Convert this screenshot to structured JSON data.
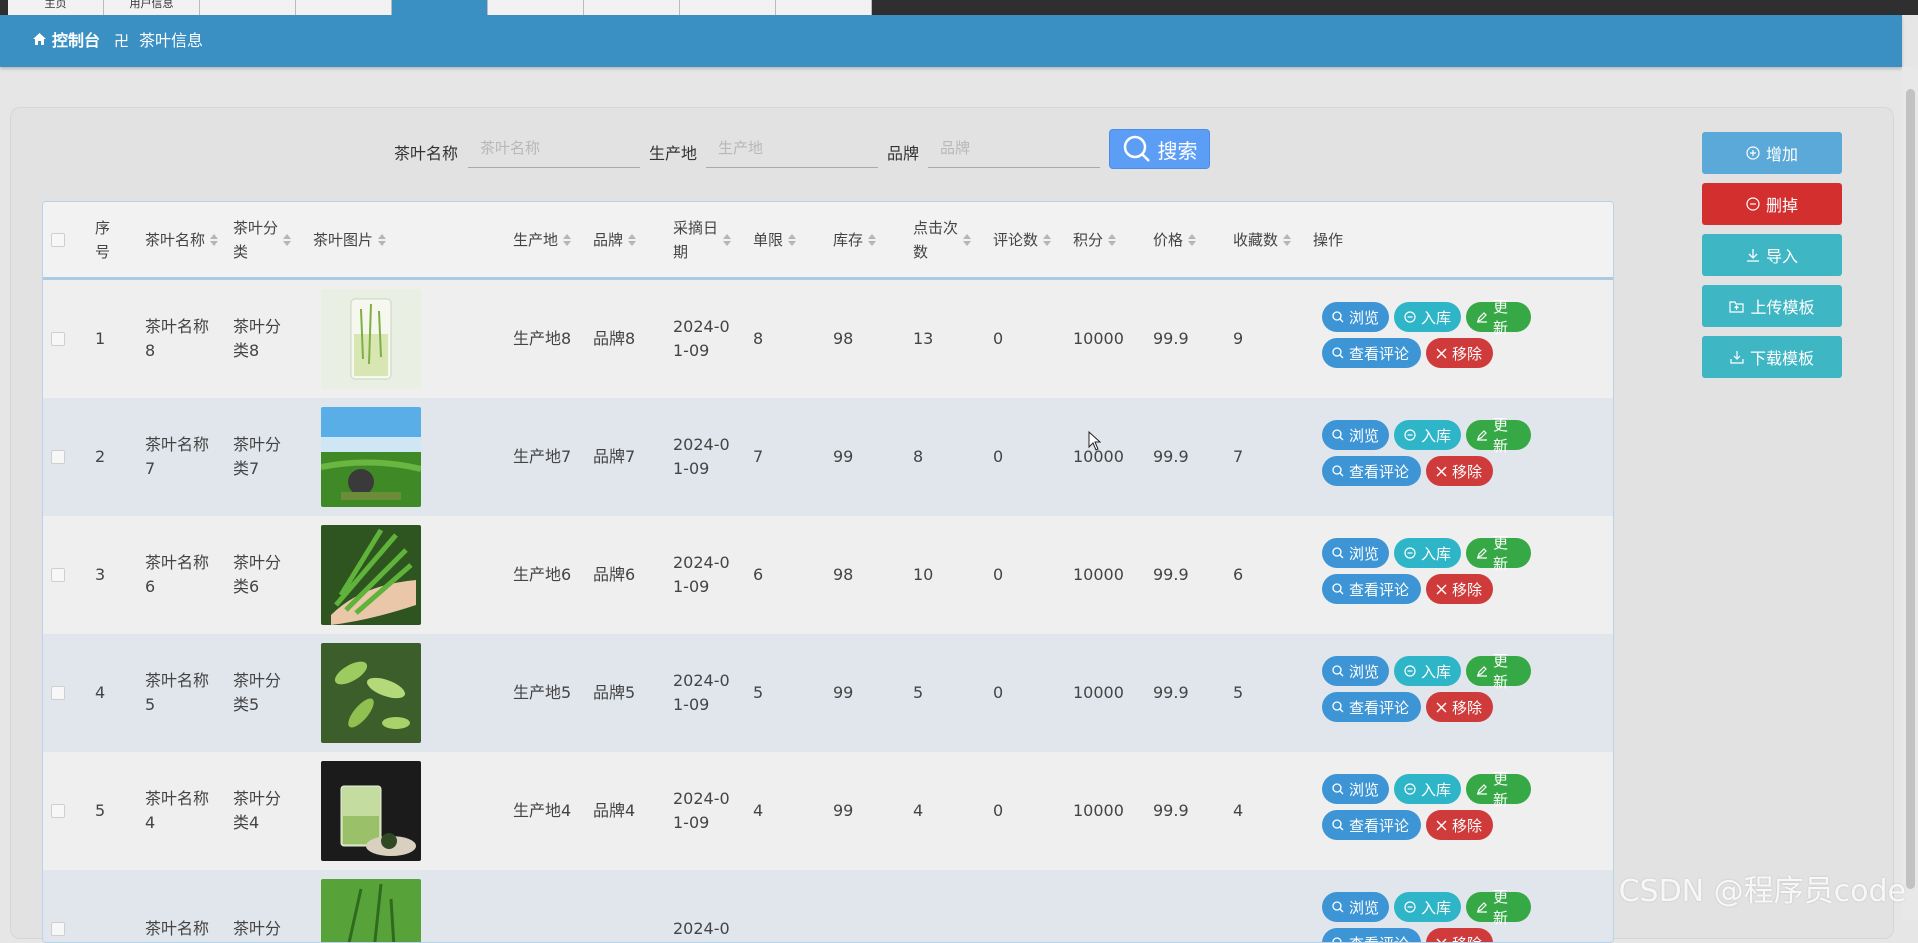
{
  "tabs": [
    {
      "label": "主页",
      "active": false
    },
    {
      "label": "用户信息",
      "active": false
    },
    {
      "label": "",
      "active": false
    },
    {
      "label": "",
      "active": false
    },
    {
      "label": "",
      "active": true
    },
    {
      "label": "",
      "active": false
    },
    {
      "label": "",
      "active": false
    },
    {
      "label": "",
      "active": false
    },
    {
      "label": "",
      "active": false
    }
  ],
  "breadcrumb": {
    "home": "控制台",
    "separator": "卍",
    "current": "茶叶信息"
  },
  "search": {
    "name_label": "茶叶名称",
    "name_placeholder": "茶叶名称",
    "origin_label": "生产地",
    "origin_placeholder": "生产地",
    "brand_label": "品牌",
    "brand_placeholder": "品牌",
    "button_label": "搜索"
  },
  "side_buttons": {
    "add": "增加",
    "delete": "删掉",
    "import": "导入",
    "upload": "上传模板",
    "download": "下载模板"
  },
  "table": {
    "headers": {
      "index": "序号",
      "name": "茶叶名称",
      "category": "茶叶分类",
      "image": "茶叶图片",
      "origin": "生产地",
      "brand": "品牌",
      "pick_date": "采摘日期",
      "limit": "单限",
      "stock": "库存",
      "clicks": "点击次数",
      "comments": "评论数",
      "points": "积分",
      "price": "价格",
      "favorites": "收藏数",
      "actions": "操作"
    },
    "rows": [
      {
        "index": "1",
        "name": "茶叶名称8",
        "category": "茶叶分类8",
        "image": "tea-cup",
        "origin": "生产地8",
        "brand": "品牌8",
        "pick_date": "2024-01-09",
        "limit": "8",
        "stock": "98",
        "clicks": "13",
        "comments": "0",
        "points": "10000",
        "price": "99.9",
        "favorites": "9"
      },
      {
        "index": "2",
        "name": "茶叶名称7",
        "category": "茶叶分类7",
        "image": "tea-field",
        "origin": "生产地7",
        "brand": "品牌7",
        "pick_date": "2024-01-09",
        "limit": "7",
        "stock": "99",
        "clicks": "8",
        "comments": "0",
        "points": "10000",
        "price": "99.9",
        "favorites": "7"
      },
      {
        "index": "3",
        "name": "茶叶名称6",
        "category": "茶叶分类6",
        "image": "tea-hand",
        "origin": "生产地6",
        "brand": "品牌6",
        "pick_date": "2024-01-09",
        "limit": "6",
        "stock": "98",
        "clicks": "10",
        "comments": "0",
        "points": "10000",
        "price": "99.9",
        "favorites": "6"
      },
      {
        "index": "4",
        "name": "茶叶名称5",
        "category": "茶叶分类5",
        "image": "tea-leaves",
        "origin": "生产地5",
        "brand": "品牌5",
        "pick_date": "2024-01-09",
        "limit": "5",
        "stock": "99",
        "clicks": "5",
        "comments": "0",
        "points": "10000",
        "price": "99.9",
        "favorites": "5"
      },
      {
        "index": "5",
        "name": "茶叶名称4",
        "category": "茶叶分类4",
        "image": "tea-glass",
        "origin": "生产地4",
        "brand": "品牌4",
        "pick_date": "2024-01-09",
        "limit": "4",
        "stock": "99",
        "clicks": "4",
        "comments": "0",
        "points": "10000",
        "price": "99.9",
        "favorites": "4"
      },
      {
        "index": "",
        "name": "茶叶名称",
        "category": "茶叶分",
        "image": "tea-green",
        "origin": "",
        "brand": "",
        "pick_date": "2024-0",
        "limit": "",
        "stock": "",
        "clicks": "",
        "comments": "",
        "points": "",
        "price": "",
        "favorites": ""
      }
    ],
    "row_actions": {
      "browse": "浏览",
      "stock_in": "入库",
      "update": "更新",
      "reviews": "查看评论",
      "remove": "移除"
    }
  },
  "watermark": "CSDN @程序员code",
  "colors": {
    "header_blue": "#3a8fc3",
    "search_blue": "#5c9ef5",
    "delete_red": "#d32f2f",
    "teal": "#3fb6c4",
    "add_blue": "#5aa9d8"
  }
}
